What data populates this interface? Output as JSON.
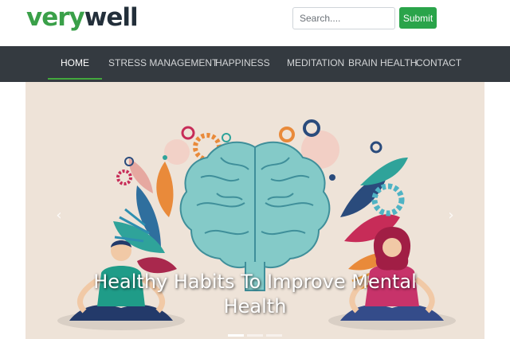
{
  "brand": {
    "part1": "very",
    "part2": "well"
  },
  "search": {
    "placeholder": "Search....",
    "value": "",
    "submit_label": "Submit"
  },
  "nav": {
    "items": [
      {
        "label": "HOME",
        "active": true
      },
      {
        "label": "STRESS MANAGEMENT",
        "active": false
      },
      {
        "label": "HAPPINESS",
        "active": false
      },
      {
        "label": "MEDITATION",
        "active": false
      },
      {
        "label": "BRAIN HEALTH",
        "active": false
      },
      {
        "label": "CONTACT",
        "active": false
      }
    ]
  },
  "carousel": {
    "caption": "Healthy Habits To Improve Mental Health",
    "prev_icon": "chevron-left-icon",
    "next_icon": "chevron-right-icon",
    "slide_count": 3,
    "active_slide": 1
  },
  "colors": {
    "brand_green": "#3aa049",
    "brand_dark": "#232f3a",
    "navbar_bg": "#343a40",
    "submit_bg": "#2aa44a",
    "active_underline": "#43a83d",
    "hero_bg": "#eee3d8"
  }
}
